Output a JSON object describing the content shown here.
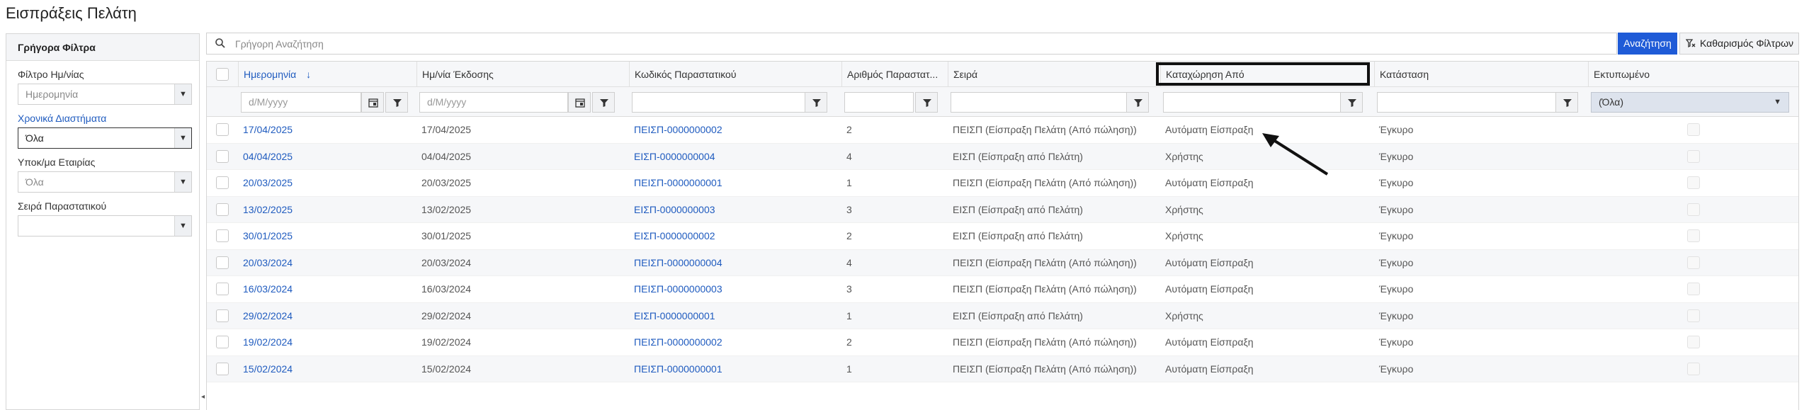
{
  "title": "Εισπράξεις Πελάτη",
  "sidebar": {
    "header": "Γρήγορα Φίλτρα",
    "filters": [
      {
        "label": "Φίλτρο Ημ/νίας",
        "value": "Ημερομηνία"
      },
      {
        "label": "Χρονικά Διαστήματα",
        "value": "Όλα"
      },
      {
        "label": "Υποκ/μα Εταιρίας",
        "value": "Όλα"
      },
      {
        "label": "Σειρά Παραστατικού",
        "value": ""
      }
    ]
  },
  "search": {
    "placeholder": "Γρήγορη Αναζήτηση",
    "search_label": "Αναζήτηση",
    "clear_label": "Καθαρισμός Φίλτρων"
  },
  "grid": {
    "columns": [
      "Ημερομηνία",
      "Ημ/νία Έκδοσης",
      "Κωδικός Παραστατικού",
      "Αριθμός Παραστατ...",
      "Σειρά",
      "Καταχώρηση Από",
      "Κατάσταση",
      "Εκτυπωμένο"
    ],
    "filters": {
      "date_placeholder": "d/M/yyyy",
      "issue_date_placeholder": "d/M/yyyy",
      "printed_option": "(Όλα)"
    },
    "rows": [
      {
        "date": "17/04/2025",
        "issue": "17/04/2025",
        "code": "ΠΕΙΣΠ-0000000002",
        "num": "2",
        "series": "ΠΕΙΣΠ (Είσπραξη Πελάτη (Από πώληση))",
        "by": "Αυτόματη Είσπραξη",
        "status": "Έγκυρο"
      },
      {
        "date": "04/04/2025",
        "issue": "04/04/2025",
        "code": "ΕΙΣΠ-0000000004",
        "num": "4",
        "series": "ΕΙΣΠ (Είσπραξη από Πελάτη)",
        "by": "Χρήστης",
        "status": "Έγκυρο"
      },
      {
        "date": "20/03/2025",
        "issue": "20/03/2025",
        "code": "ΠΕΙΣΠ-0000000001",
        "num": "1",
        "series": "ΠΕΙΣΠ (Είσπραξη Πελάτη (Από πώληση))",
        "by": "Αυτόματη Είσπραξη",
        "status": "Έγκυρο"
      },
      {
        "date": "13/02/2025",
        "issue": "13/02/2025",
        "code": "ΕΙΣΠ-0000000003",
        "num": "3",
        "series": "ΕΙΣΠ (Είσπραξη από Πελάτη)",
        "by": "Χρήστης",
        "status": "Έγκυρο"
      },
      {
        "date": "30/01/2025",
        "issue": "30/01/2025",
        "code": "ΕΙΣΠ-0000000002",
        "num": "2",
        "series": "ΕΙΣΠ (Είσπραξη από Πελάτη)",
        "by": "Χρήστης",
        "status": "Έγκυρο"
      },
      {
        "date": "20/03/2024",
        "issue": "20/03/2024",
        "code": "ΠΕΙΣΠ-0000000004",
        "num": "4",
        "series": "ΠΕΙΣΠ (Είσπραξη Πελάτη (Από πώληση))",
        "by": "Αυτόματη Είσπραξη",
        "status": "Έγκυρο"
      },
      {
        "date": "16/03/2024",
        "issue": "16/03/2024",
        "code": "ΠΕΙΣΠ-0000000003",
        "num": "3",
        "series": "ΠΕΙΣΠ (Είσπραξη Πελάτη (Από πώληση))",
        "by": "Αυτόματη Είσπραξη",
        "status": "Έγκυρο"
      },
      {
        "date": "29/02/2024",
        "issue": "29/02/2024",
        "code": "ΕΙΣΠ-0000000001",
        "num": "1",
        "series": "ΕΙΣΠ (Είσπραξη από Πελάτη)",
        "by": "Χρήστης",
        "status": "Έγκυρο"
      },
      {
        "date": "19/02/2024",
        "issue": "19/02/2024",
        "code": "ΠΕΙΣΠ-0000000002",
        "num": "2",
        "series": "ΠΕΙΣΠ (Είσπραξη Πελάτη (Από πώληση))",
        "by": "Αυτόματη Είσπραξη",
        "status": "Έγκυρο"
      },
      {
        "date": "15/02/2024",
        "issue": "15/02/2024",
        "code": "ΠΕΙΣΠ-0000000001",
        "num": "1",
        "series": "ΠΕΙΣΠ (Είσπραξη Πελάτη (Από πώληση))",
        "by": "Αυτόματη Είσπραξη",
        "status": "Έγκυρο"
      }
    ]
  },
  "colors": {
    "accent": "#1f5bd7",
    "link": "#1f5bbf"
  }
}
